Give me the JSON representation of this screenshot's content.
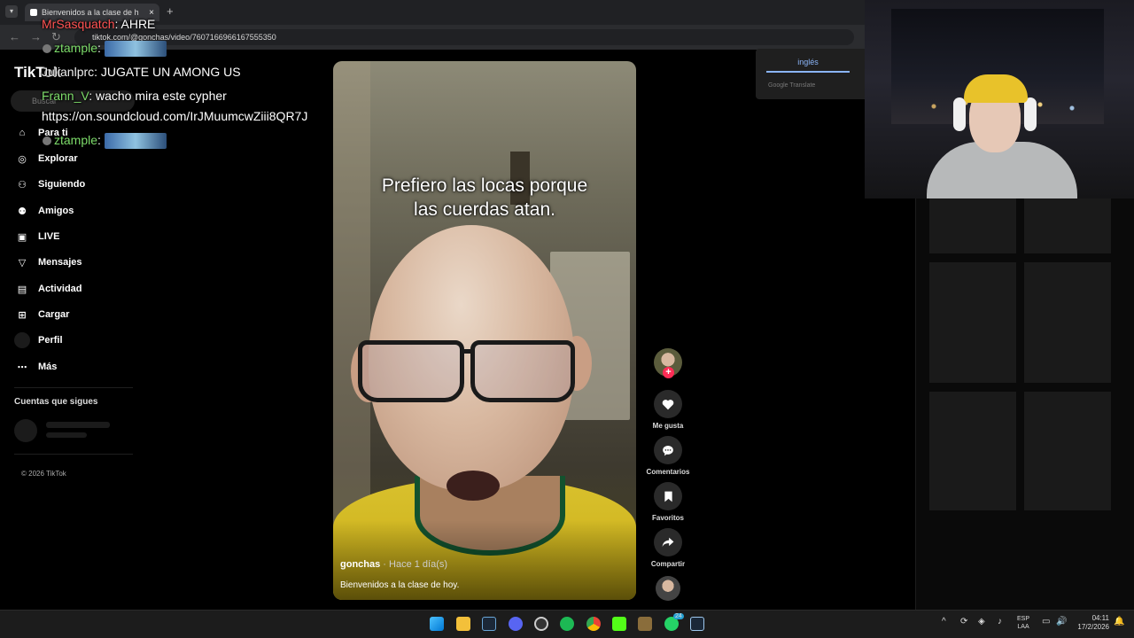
{
  "browser": {
    "tab_title": "Bienvenidos a la clase de h",
    "tab_close": "×",
    "new_tab": "+",
    "url": "tiktok.com/@gonchas/video/7607166966167555350"
  },
  "tiktok": {
    "logo": "TikTok",
    "search_placeholder": "Buscar",
    "nav": [
      {
        "label": "Para ti",
        "icon": "home-icon"
      },
      {
        "label": "Explorar",
        "icon": "compass-icon"
      },
      {
        "label": "Siguiendo",
        "icon": "user-plus-icon"
      },
      {
        "label": "Amigos",
        "icon": "friends-icon"
      },
      {
        "label": "LIVE",
        "icon": "live-icon"
      },
      {
        "label": "Mensajes",
        "icon": "send-icon"
      },
      {
        "label": "Actividad",
        "icon": "activity-icon"
      },
      {
        "label": "Cargar",
        "icon": "upload-icon"
      },
      {
        "label": "Perfil",
        "icon": "profile-icon"
      },
      {
        "label": "Más",
        "icon": "more-icon"
      }
    ],
    "following_title": "Cuentas que sigues",
    "copyright": "© 2026 TikTok"
  },
  "video": {
    "caption_line1": "Prefiero las locas porque",
    "caption_line2": "las cuerdas atan.",
    "author": "gonchas",
    "time_ago": " · Hace 1 día(s)",
    "description": "Bienvenidos a la clase de hoy."
  },
  "actions": {
    "like": "Me gusta",
    "comments": "Comentarios",
    "favorites": "Favoritos",
    "share": "Compartir",
    "follow_plus": "+"
  },
  "translate": {
    "language": "inglés",
    "brand": "Google Translate"
  },
  "chat": [
    {
      "user": "MrSasquatch",
      "text": ": AHRE"
    },
    {
      "user": "ztample",
      "text": ":"
    },
    {
      "user": "Julianlprc",
      "text": ": JUGATE UN AMONG US"
    },
    {
      "user": "Frann_V",
      "text": ": wacho mira este cypher"
    },
    {
      "user": "",
      "text": "https://on.soundcloud.com/IrJMuumcwZiii8QR7J"
    },
    {
      "user": "ztample",
      "text": ":"
    }
  ],
  "taskbar": {
    "lang_line1": "ESP",
    "lang_line2": "LAA",
    "time": "04:11",
    "date": "17/2/2026",
    "whatsapp_badge": "24",
    "up_arrow": "^"
  },
  "colors": {
    "accent": "#fe2c55",
    "translate_blue": "#8ab4f8",
    "chat_user_green": "#00e676"
  }
}
